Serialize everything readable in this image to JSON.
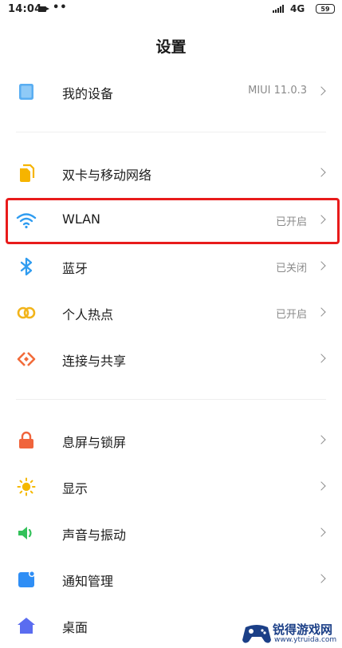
{
  "status_bar": {
    "time": "14:04",
    "dots": "••",
    "network": "4G",
    "battery": "59"
  },
  "header": {
    "title": "设置"
  },
  "sections": [
    {
      "items": [
        {
          "label": "我的设备",
          "value": "MIUI 11.0.3",
          "icon": "device-icon",
          "color": "#5aaef2"
        }
      ]
    },
    {
      "items": [
        {
          "label": "双卡与移动网络",
          "value": "",
          "icon": "sim-card-icon",
          "color": "#f6b400"
        },
        {
          "label": "WLAN",
          "value": "已开启",
          "icon": "wifi-icon",
          "color": "#2f9cf0"
        },
        {
          "label": "蓝牙",
          "value": "已关闭",
          "icon": "bluetooth-icon",
          "color": "#2f9cf0"
        },
        {
          "label": "个人热点",
          "value": "已开启",
          "icon": "hotspot-icon",
          "color": "#f2b41a"
        },
        {
          "label": "连接与共享",
          "value": "",
          "icon": "share-icon",
          "color": "#f26b3a"
        }
      ]
    },
    {
      "items": [
        {
          "label": "息屏与锁屏",
          "value": "",
          "icon": "lock-icon",
          "color": "#f0643c"
        },
        {
          "label": "显示",
          "value": "",
          "icon": "sun-icon",
          "color": "#f5b800"
        },
        {
          "label": "声音与振动",
          "value": "",
          "icon": "speaker-icon",
          "color": "#33c15a"
        },
        {
          "label": "通知管理",
          "value": "",
          "icon": "notification-icon",
          "color": "#2f8ef5"
        },
        {
          "label": "桌面",
          "value": "",
          "icon": "home-icon",
          "color": "#5a6cf0"
        }
      ]
    }
  ],
  "watermark": {
    "title": "锐得游戏网",
    "url": "www.ytruida.com"
  },
  "colors": {
    "highlight": "#e81b1b",
    "text_primary": "#1d1d1d",
    "text_secondary": "#8a8a8a"
  }
}
